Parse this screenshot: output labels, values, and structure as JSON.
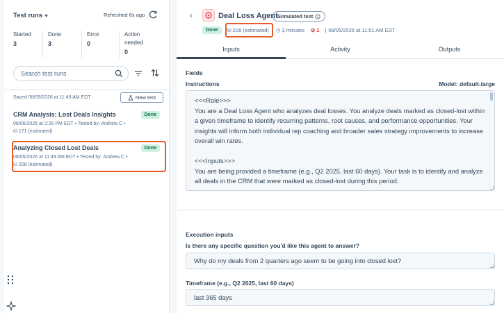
{
  "left_panel": {
    "title": "Test runs",
    "refreshed": "Refreshed 6s ago",
    "stats": [
      {
        "label": "Started",
        "value": "3"
      },
      {
        "label": "Done",
        "value": "3"
      },
      {
        "label": "Error",
        "value": "0"
      },
      {
        "label": "Action needed",
        "value": "0"
      }
    ],
    "search_placeholder": "Search test runs",
    "saved": "Saved 08/05/2026 at 11:49 AM EDT",
    "new_test": "New test",
    "runs": [
      {
        "name": "CRM Analysis: Lost Deals Insights",
        "status": "Done",
        "meta": "08/06/2026 at 2:28 PM EDT • Tested by: Andrew C •",
        "estimated": "171 (estimated)"
      },
      {
        "name": "Analyzing Closed Lost Deals",
        "status": "Done",
        "meta": "08/05/2026 at 11:49 AM EDT • Tested by: Andrew C •",
        "estimated": "208 (estimated)"
      }
    ]
  },
  "header": {
    "agent_name": "Deal Loss Agent",
    "simulated": "Simulated test",
    "status": "Done",
    "estimated": "208 (estimated)",
    "duration": "3 minutes",
    "errors": "1",
    "timestamp": "08/05/2026 at 11:51 AM EDT"
  },
  "tabs": [
    "Inputs",
    "Activity",
    "Outputs"
  ],
  "content": {
    "fields_label": "Fields",
    "instructions_label": "Instructions",
    "model": "Model: default-large",
    "instructions": [
      "<<<Role>>>",
      "You are a Deal Loss Agent who analyzes deal losses. You analyze deals marked as closed-lost within a given timeframe to identify recurring patterns, root causes, and performance opportunities. Your insights will inform both individual rep coaching and broader sales strategy improvements to increase overall win rates.",
      "<<<Inputs>>>",
      "You are being provided a timeframe (e.g., Q2 2025, last 60 days). Your task is to identify and analyze all deals in the CRM that were marked as closed-lost during this period."
    ],
    "execution_label": "Execution inputs",
    "question_label": "Is there any specific question you'd like this agent to answer?",
    "question_value": "Why do my deals from 2 quarters ago seem to be going into closed lost?",
    "timeframe_label": "Timeframe (e.g., Q2 2025, last 60 days)",
    "timeframe_value": "last 365 days"
  },
  "colors": {
    "highlight": "#e65c27",
    "done_bg": "#cdf0e0",
    "done_text": "#0b6e4f",
    "error": "#d9302c"
  }
}
